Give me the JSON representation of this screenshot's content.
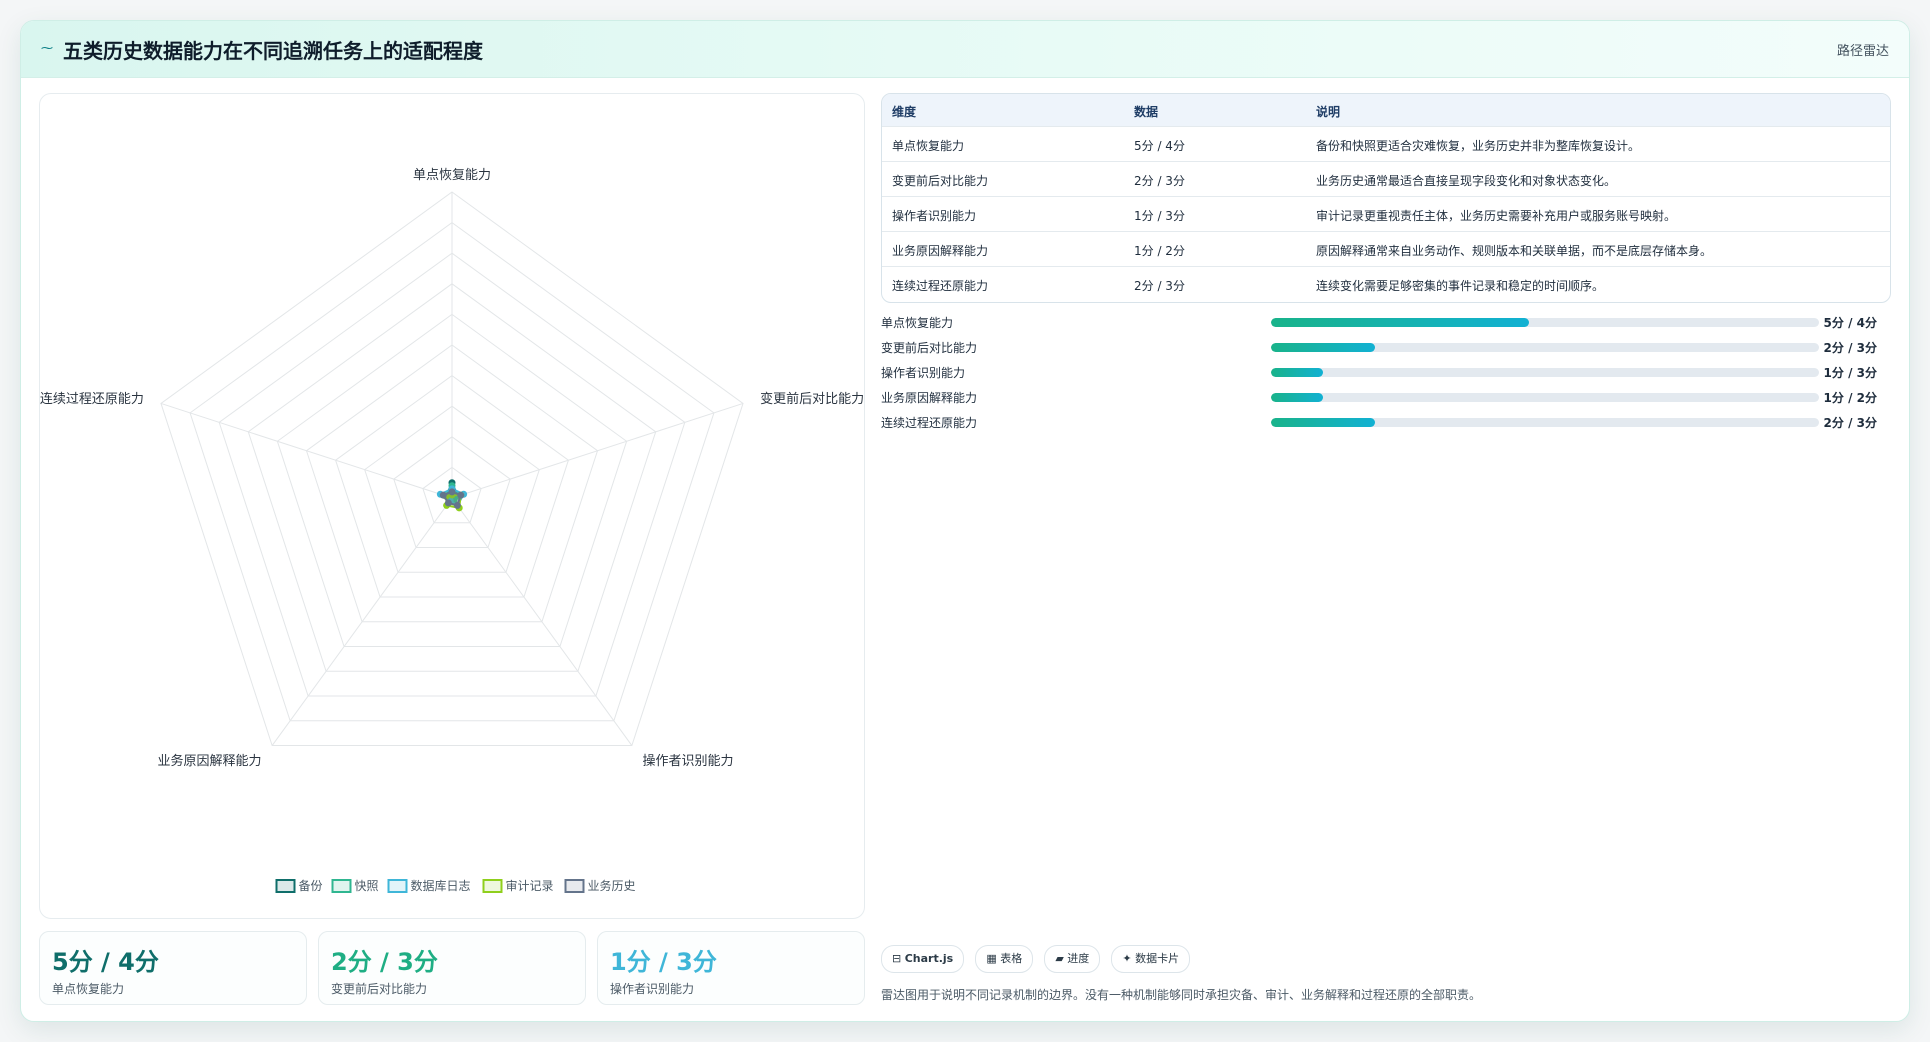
{
  "header": {
    "icon": "wave-icon",
    "title": "五类历史数据能力在不同追溯任务上的适配程度",
    "tag": "路径雷达"
  },
  "chart_data": {
    "type": "radar",
    "axes": [
      "单点恢复能力",
      "变更前后对比能力",
      "操作者识别能力",
      "业务原因解释能力",
      "连续过程还原能力"
    ],
    "scale_max": 100,
    "series": [
      {
        "name": "备份",
        "color": "#0f6e6a",
        "values": [
          5,
          2,
          1,
          1,
          2
        ]
      },
      {
        "name": "快照",
        "color": "#2fb690",
        "values": [
          4,
          2,
          1,
          1,
          2
        ]
      },
      {
        "name": "数据库日志",
        "color": "#3fb6d8",
        "values": [
          3,
          4,
          3,
          1,
          4
        ]
      },
      {
        "name": "审计记录",
        "color": "#8fcf1c",
        "values": [
          1,
          3,
          4,
          3,
          2
        ]
      },
      {
        "name": "业务历史",
        "color": "#64748b",
        "values": [
          2,
          3,
          3,
          2,
          3
        ]
      }
    ],
    "legend_position": "bottom"
  },
  "table": {
    "headers": [
      "维度",
      "数据",
      "说明"
    ],
    "rows": [
      [
        "单点恢复能力",
        "5分 / 4分",
        "备份和快照更适合灾难恢复，业务历史并非为整库恢复设计。"
      ],
      [
        "变更前后对比能力",
        "2分 / 3分",
        "业务历史通常最适合直接呈现字段变化和对象状态变化。"
      ],
      [
        "操作者识别能力",
        "1分 / 3分",
        "审计记录更重视责任主体，业务历史需要补充用户或服务账号映射。"
      ],
      [
        "业务原因解释能力",
        "1分 / 2分",
        "原因解释通常来自业务动作、规则版本和关联单据，而不是底层存储本身。"
      ],
      [
        "连续过程还原能力",
        "2分 / 3分",
        "连续变化需要足够密集的事件记录和稳定的时间顺序。"
      ]
    ]
  },
  "bars": [
    {
      "label": "单点恢复能力",
      "value_text": "5分 / 4分",
      "fraction": 0.47
    },
    {
      "label": "变更前后对比能力",
      "value_text": "2分 / 3分",
      "fraction": 0.19
    },
    {
      "label": "操作者识别能力",
      "value_text": "1分 / 3分",
      "fraction": 0.095
    },
    {
      "label": "业务原因解释能力",
      "value_text": "1分 / 2分",
      "fraction": 0.095
    },
    {
      "label": "连续过程还原能力",
      "value_text": "2分 / 3分",
      "fraction": 0.19
    }
  ],
  "stats": [
    {
      "value": "5分 / 4分",
      "label": "单点恢复能力",
      "color": "#0f6e6a"
    },
    {
      "value": "2分 / 3分",
      "label": "变更前后对比能力",
      "color": "#1fae84"
    },
    {
      "value": "1分 / 3分",
      "label": "操作者识别能力",
      "color": "#3fb6d8"
    }
  ],
  "chips": [
    {
      "icon": "chart-icon",
      "glyph": "⊟",
      "label": "Chart.js"
    },
    {
      "icon": "table-icon",
      "glyph": "▦",
      "label": "表格"
    },
    {
      "icon": "progress-icon",
      "glyph": "▰",
      "label": "进度"
    },
    {
      "icon": "card-icon",
      "glyph": "✦",
      "label": "数据卡片"
    }
  ],
  "footnote": "雷达图用于说明不同记录机制的边界。没有一种机制能够同时承担灾备、审计、业务解释和过程还原的全部职责。"
}
